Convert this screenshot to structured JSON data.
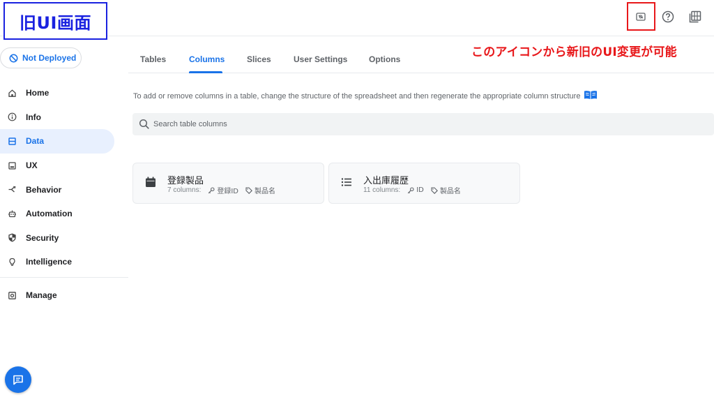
{
  "annotations": {
    "title": "旧UI画面",
    "note": "このアイコンから新旧のUI変更が可能"
  },
  "topbar": {
    "icons": [
      "toggle-ui-icon",
      "help-icon",
      "docs-icon"
    ]
  },
  "sidebar": {
    "deploy_label": "Not Deployed",
    "items": [
      {
        "label": "Home",
        "icon": "home-icon"
      },
      {
        "label": "Info",
        "icon": "info-icon"
      },
      {
        "label": "Data",
        "icon": "data-icon",
        "active": true
      },
      {
        "label": "UX",
        "icon": "ux-icon"
      },
      {
        "label": "Behavior",
        "icon": "behavior-icon"
      },
      {
        "label": "Automation",
        "icon": "automation-icon"
      },
      {
        "label": "Security",
        "icon": "security-icon"
      },
      {
        "label": "Intelligence",
        "icon": "intelligence-icon"
      }
    ],
    "manage_label": "Manage"
  },
  "tabs": [
    {
      "label": "Tables"
    },
    {
      "label": "Columns",
      "active": true
    },
    {
      "label": "Slices"
    },
    {
      "label": "User Settings"
    },
    {
      "label": "Options"
    }
  ],
  "main": {
    "info_text": "To add or remove columns in a table, change the structure of the spreadsheet and then regenerate the appropriate column structure",
    "search_placeholder": "Search table columns",
    "cards": [
      {
        "title": "登録製品",
        "count": "7 columns:",
        "key": "登録ID",
        "label": "製品名",
        "icon": "calendar-icon"
      },
      {
        "title": "入出庫履歴",
        "count": "11 columns:",
        "key": "ID",
        "label": "製品名",
        "icon": "list-icon"
      }
    ]
  },
  "colors": {
    "accent": "#1a73e8",
    "annotation_blue": "#1a22e0",
    "annotation_red": "#e8171a",
    "active_bg": "#e8f0fe"
  }
}
